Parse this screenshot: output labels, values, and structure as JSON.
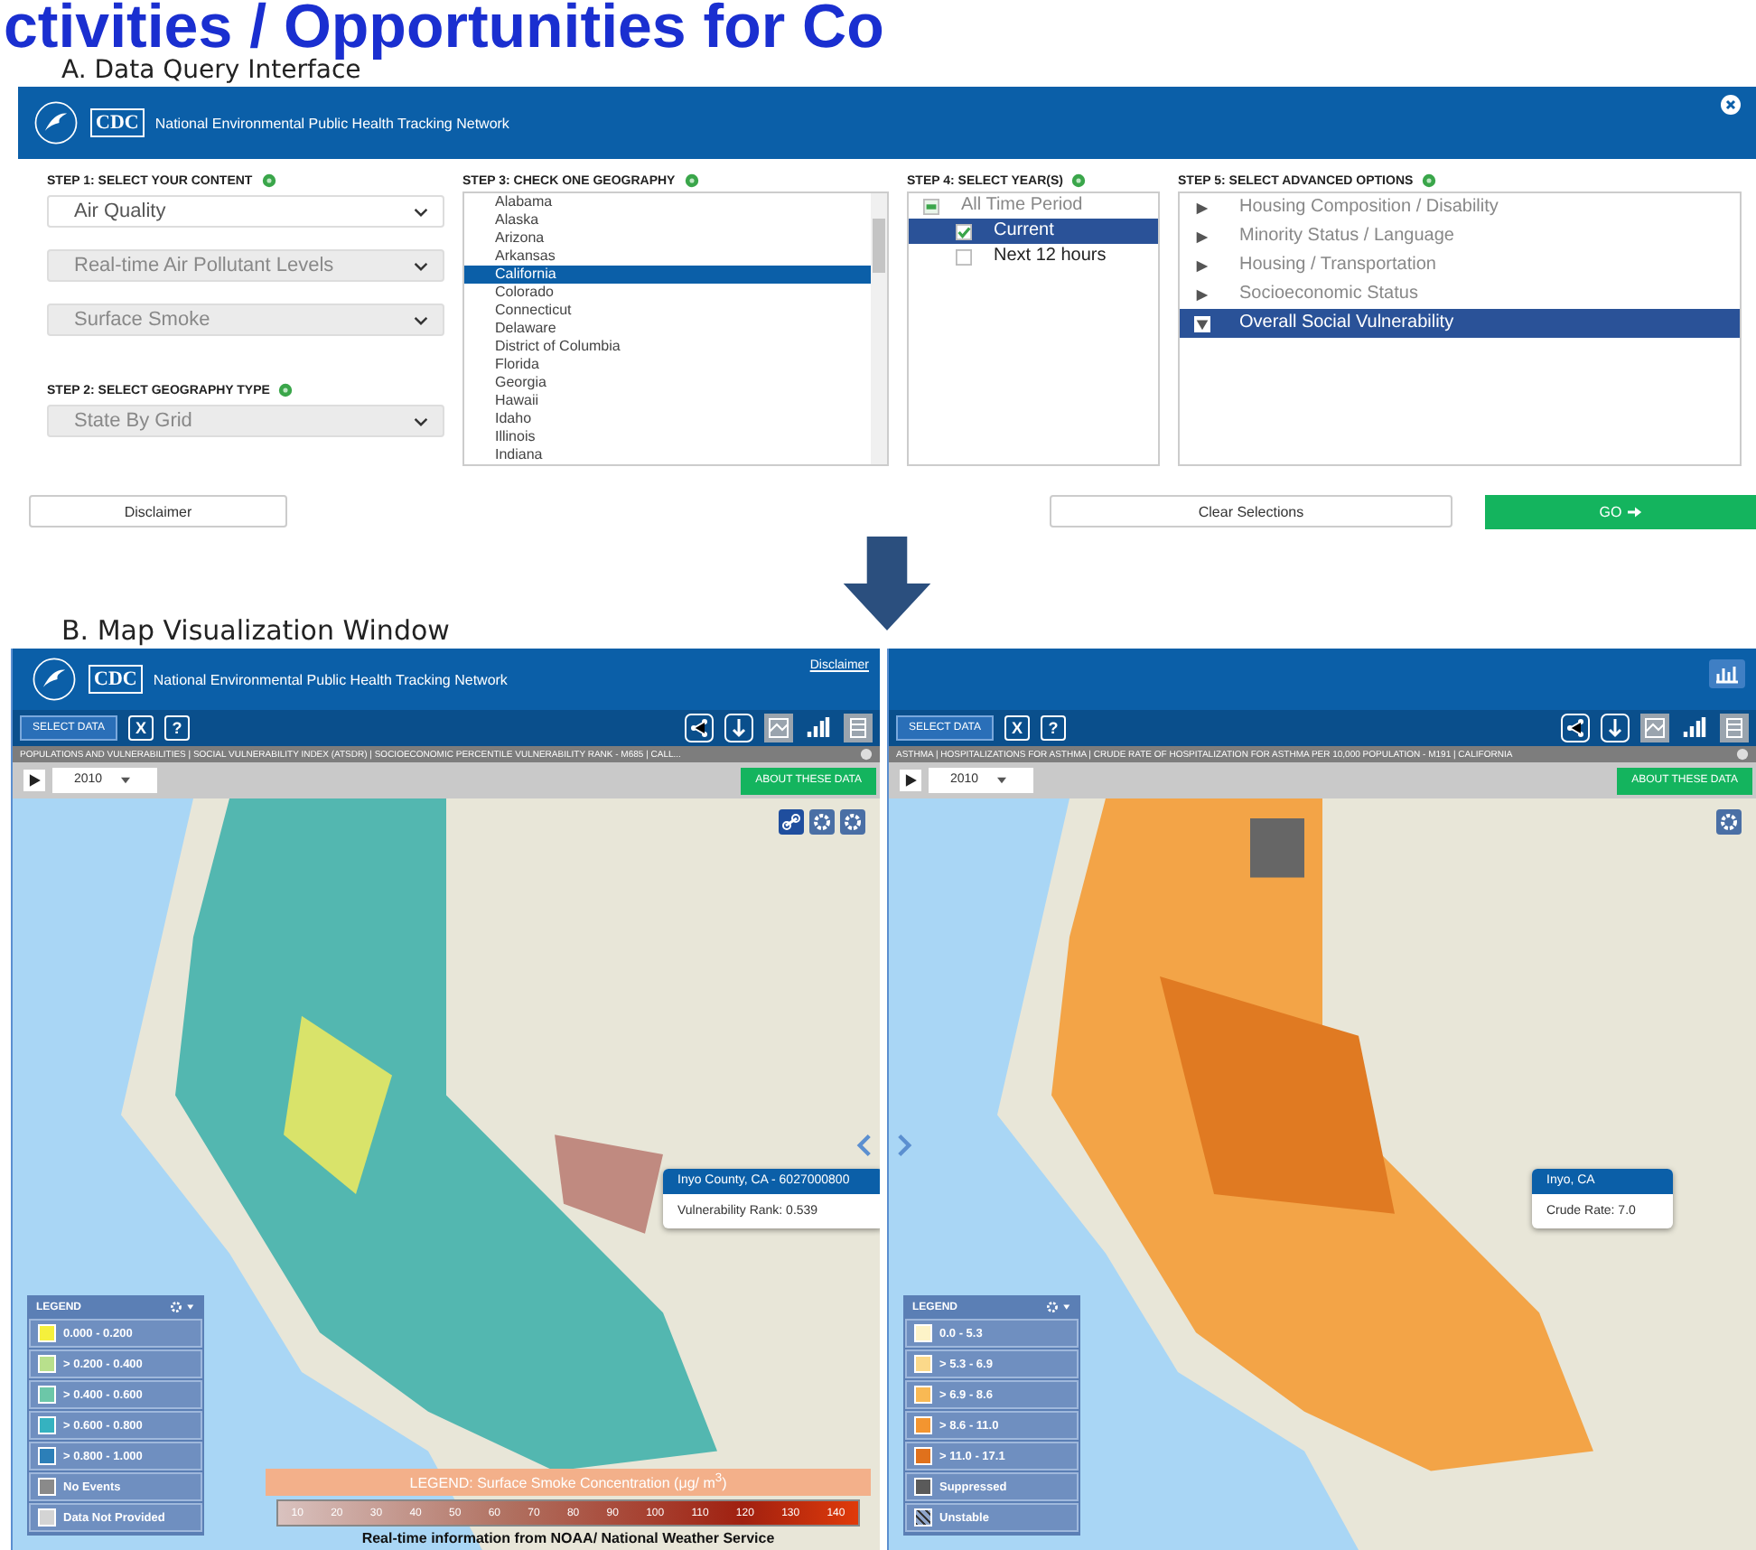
{
  "slide_title": "ctivities / Opportunities for Co",
  "query_interface": {
    "section_label": "A. Data Query Interface",
    "header": {
      "logo_text": "CDC",
      "title": "National Environmental Public Health Tracking Network"
    },
    "step1": {
      "label": "STEP 1: SELECT YOUR CONTENT",
      "selects": [
        {
          "value": "Air Quality",
          "disabled": false
        },
        {
          "value": "Real-time  Air Pollutant  Levels",
          "disabled": true
        },
        {
          "value": "Surface Smoke",
          "disabled": true
        }
      ]
    },
    "step2": {
      "label": "STEP 2: SELECT GEOGRAPHY TYPE",
      "select": {
        "value": "State  By Grid",
        "disabled": true
      }
    },
    "step3": {
      "label": "STEP 3: CHECK ONE GEOGRAPHY",
      "items": [
        {
          "label": "Alabama",
          "selected": false
        },
        {
          "label": "Alaska",
          "selected": false
        },
        {
          "label": "Arizona",
          "selected": false
        },
        {
          "label": "Arkansas",
          "selected": false
        },
        {
          "label": "California",
          "selected": true
        },
        {
          "label": "Colorado",
          "selected": false
        },
        {
          "label": "Connecticut",
          "selected": false
        },
        {
          "label": "Delaware",
          "selected": false
        },
        {
          "label": "District of Columbia",
          "selected": false
        },
        {
          "label": "Florida",
          "selected": false
        },
        {
          "label": "Georgia",
          "selected": false
        },
        {
          "label": "Hawaii",
          "selected": false
        },
        {
          "label": "Idaho",
          "selected": false
        },
        {
          "label": "Illinois",
          "selected": false
        },
        {
          "label": "Indiana",
          "selected": false
        }
      ]
    },
    "step4": {
      "label": "STEP 4: SELECT YEAR(S)",
      "items": [
        {
          "label": "All Time Period",
          "kind": "group",
          "checked": false,
          "selected": false
        },
        {
          "label": "Current",
          "kind": "option",
          "checked": true,
          "selected": true
        },
        {
          "label": "Next  12 hours",
          "kind": "option",
          "checked": false,
          "selected": false
        }
      ]
    },
    "step5": {
      "label": "STEP 5: SELECT ADVANCED OPTIONS",
      "items": [
        {
          "label": "Housing  Composition  / Disability",
          "expanded": false,
          "selected": false
        },
        {
          "label": "Minority Status  / Language",
          "expanded": false,
          "selected": false
        },
        {
          "label": "Housing  / Transportation",
          "expanded": false,
          "selected": false
        },
        {
          "label": "Socioeconomic Status",
          "expanded": false,
          "selected": false
        },
        {
          "label": "Overall  Social Vulnerability",
          "expanded": true,
          "selected": true
        }
      ]
    },
    "buttons": {
      "disclaimer": "Disclaimer",
      "clear": "Clear Selections",
      "go": "GO"
    }
  },
  "map_section_label": "B. Map Visualization Window",
  "map_windows": [
    {
      "header": {
        "logo_text": "CDC",
        "title": "National Environmental Public Health Tracking Network",
        "disclaimer": "Disclaimer"
      },
      "select_button": "SELECT DATA",
      "close_label": "X",
      "help_label": "?",
      "breadcrumb": "POPULATIONS AND VULNERABILITIES | SOCIAL VULNERABILITY INDEX (ATSDR) | SOCIOECONOMIC PERCENTILE VULNERABILITY RANK - M685 | CALL...",
      "year": "2010",
      "about_button": "ABOUT THESE DATA",
      "tooltip": {
        "title": "Inyo County, CA - 6027000800",
        "text": "Vulnerability Rank: 0.539"
      },
      "legend": {
        "title": "LEGEND",
        "items": [
          {
            "label": "0.000 - 0.200",
            "color": "#f5f03c",
            "kind": "swatch"
          },
          {
            "label": "> 0.200 - 0.400",
            "color": "#b8e08c",
            "kind": "swatch"
          },
          {
            "label": "> 0.400 - 0.600",
            "color": "#6cc7a8",
            "kind": "swatch"
          },
          {
            "label": "> 0.600 - 0.800",
            "color": "#35b2c0",
            "kind": "swatch"
          },
          {
            "label": "> 0.800 - 1.000",
            "color": "#2c7fb8",
            "kind": "swatch"
          },
          {
            "label": "No Events",
            "color": "#8a8a8a",
            "kind": "swatch"
          },
          {
            "label": "Data Not Provided",
            "color": "#d4d4d4",
            "kind": "swatch"
          }
        ]
      },
      "smoke_legend": {
        "title": "LEGEND:  Surface Smoke Concentration  (μg/ m$^{3}$)",
        "ticks": [
          "10",
          "20",
          "30",
          "40",
          "50",
          "60",
          "70",
          "80",
          "90",
          "100",
          "110",
          "120",
          "130",
          "140"
        ],
        "caption": "Real-time information  from NOAA/  National Weather Service"
      }
    },
    {
      "select_button": "SELECT DATA",
      "close_label": "X",
      "help_label": "?",
      "breadcrumb": "ASTHMA | HOSPITALIZATIONS FOR ASTHMA | CRUDE RATE OF HOSPITALIZATION FOR ASTHMA PER 10,000 POPULATION - M191 | CALIFORNIA",
      "year": "2010",
      "about_button": "ABOUT THESE DATA",
      "tooltip": {
        "title": "Inyo, CA",
        "text": "Crude Rate: 7.0"
      },
      "legend": {
        "title": "LEGEND",
        "items": [
          {
            "label": "0.0 - 5.3",
            "color": "#fdf3c8",
            "kind": "swatch"
          },
          {
            "label": "> 5.3 - 6.9",
            "color": "#fbd98a",
            "kind": "swatch"
          },
          {
            "label": "> 6.9 - 8.6",
            "color": "#f9b954",
            "kind": "swatch"
          },
          {
            "label": "> 8.6 - 11.0",
            "color": "#f39530",
            "kind": "swatch"
          },
          {
            "label": "> 11.0 - 17.1",
            "color": "#e0711c",
            "kind": "swatch"
          },
          {
            "label": "Suppressed",
            "color": "#5a5a5a",
            "kind": "swatch"
          },
          {
            "label": "Unstable",
            "color": "#8ea4c8",
            "kind": "hatched"
          }
        ]
      }
    }
  ]
}
